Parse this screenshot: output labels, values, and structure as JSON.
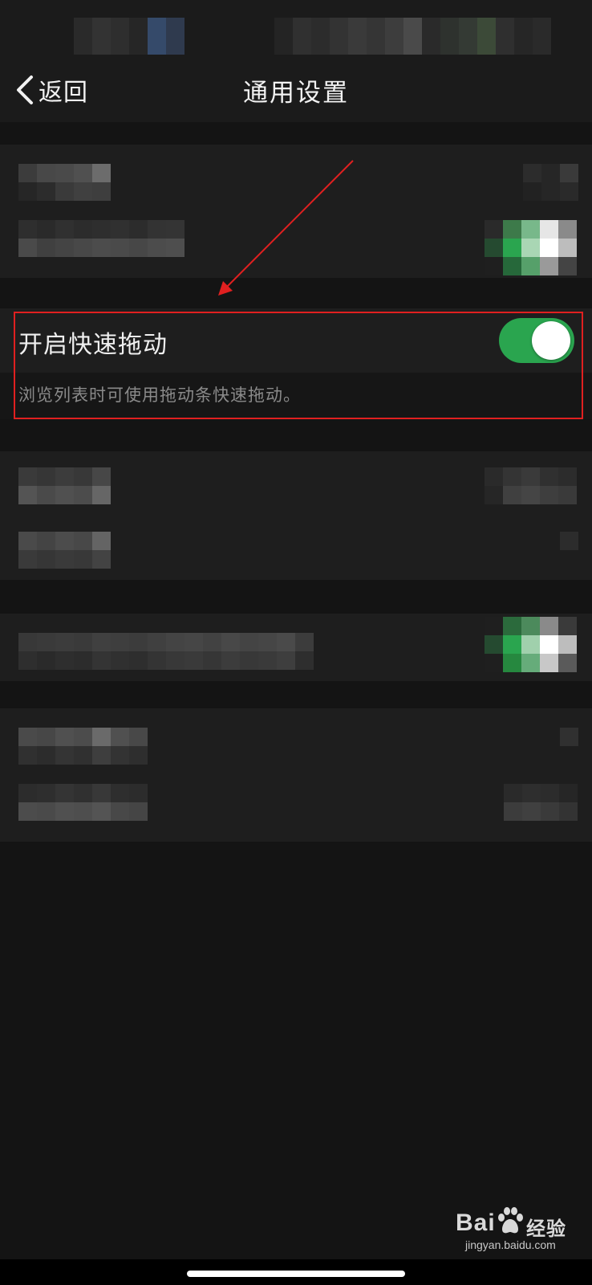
{
  "nav": {
    "back_label": "返回",
    "title": "通用设置"
  },
  "quick_drag": {
    "label": "开启快速拖动",
    "description": "浏览列表时可使用拖动条快速拖动。",
    "enabled": true
  },
  "colors": {
    "toggle_on": "#2aa54f",
    "annotation": "#e02020",
    "background": "#111111",
    "section": "#1e1e1e"
  },
  "icons": [
    "chevron-left-icon",
    "baidu-paw-icon"
  ],
  "watermark": {
    "text": "Bai",
    "text2": "经验",
    "url": "jingyan.baidu.com"
  }
}
